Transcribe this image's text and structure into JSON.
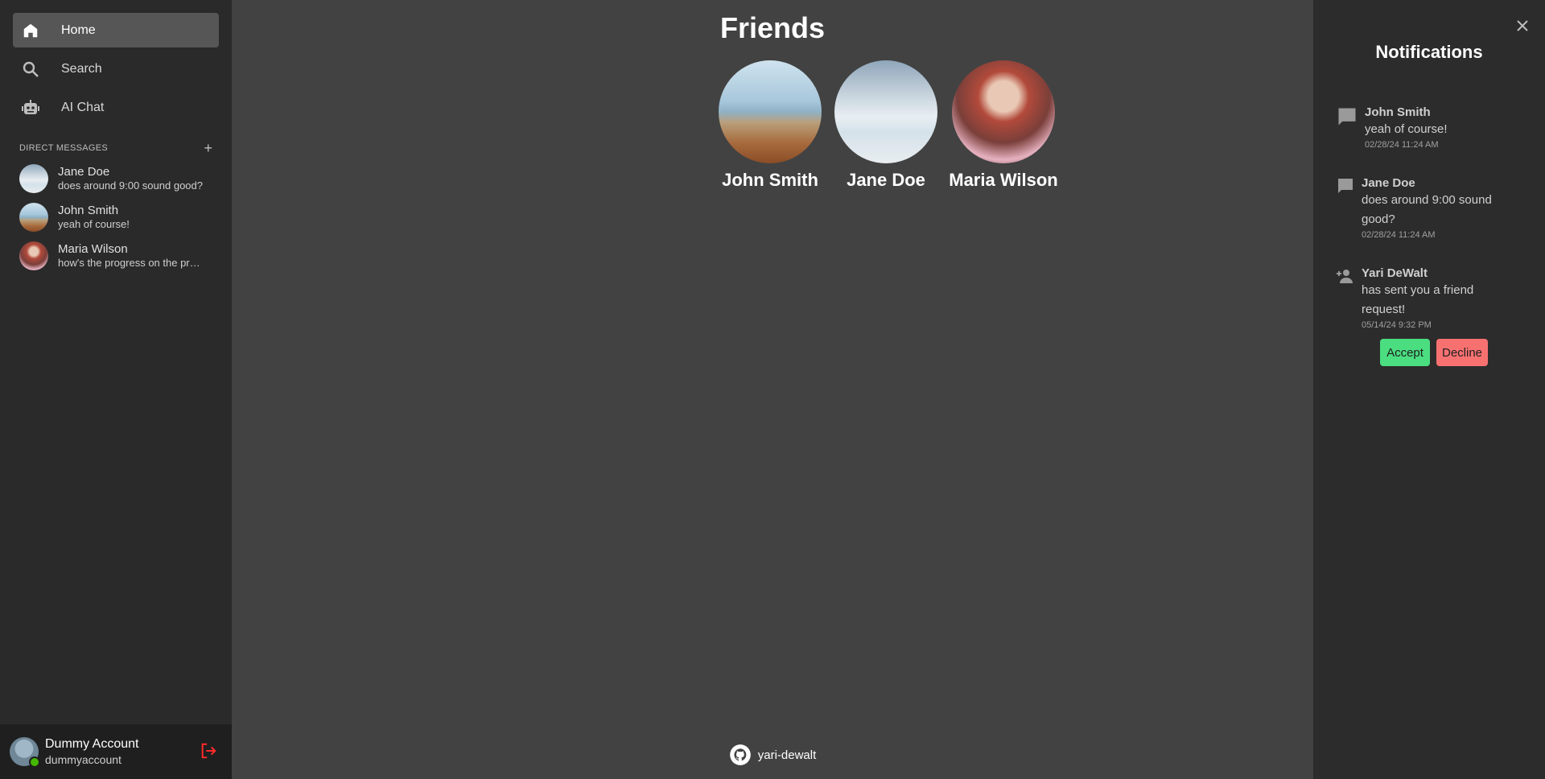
{
  "sidebar": {
    "nav": [
      {
        "label": "Home",
        "icon": "home-icon",
        "active": true
      },
      {
        "label": "Search",
        "icon": "search-icon",
        "active": false
      },
      {
        "label": "AI Chat",
        "icon": "robot-icon",
        "active": false
      }
    ],
    "dm_title": "DIRECT MESSAGES",
    "dm_add": "+",
    "dms": [
      {
        "name": "Jane Doe",
        "preview": "does around 9:00 sound good?"
      },
      {
        "name": "John Smith",
        "preview": "yeah of course!"
      },
      {
        "name": "Maria Wilson",
        "preview": "how's the progress on the project?"
      }
    ],
    "account": {
      "name": "Dummy Account",
      "username": "dummyaccount",
      "status": "online"
    }
  },
  "main": {
    "title": "Friends",
    "friends": [
      {
        "name": "John Smith"
      },
      {
        "name": "Jane Doe"
      },
      {
        "name": "Maria Wilson"
      }
    ],
    "footer": {
      "label": "yari-dewalt",
      "icon": "github-icon"
    }
  },
  "notifications": {
    "title": "Notifications",
    "items": [
      {
        "type": "message",
        "icon": "chat-icon",
        "name": "John Smith",
        "message": "yeah of course!",
        "time": "02/28/24 11:24 AM"
      },
      {
        "type": "message",
        "icon": "chat-icon",
        "name": "Jane Doe",
        "message": "does around 9:00 sound good?",
        "time": "02/28/24 11:24 AM"
      },
      {
        "type": "friend_request",
        "icon": "person-add-icon",
        "name": "Yari DeWalt",
        "message": "has sent you a friend request!",
        "time": "05/14/24 9:32 PM",
        "accept_label": "Accept",
        "decline_label": "Decline"
      }
    ]
  },
  "colors": {
    "sidebar_bg": "#2a2a2a",
    "main_bg": "#424242",
    "accept": "#4ade80",
    "decline": "#f87171",
    "logout": "#ff2a2a",
    "online": "#44b700"
  }
}
